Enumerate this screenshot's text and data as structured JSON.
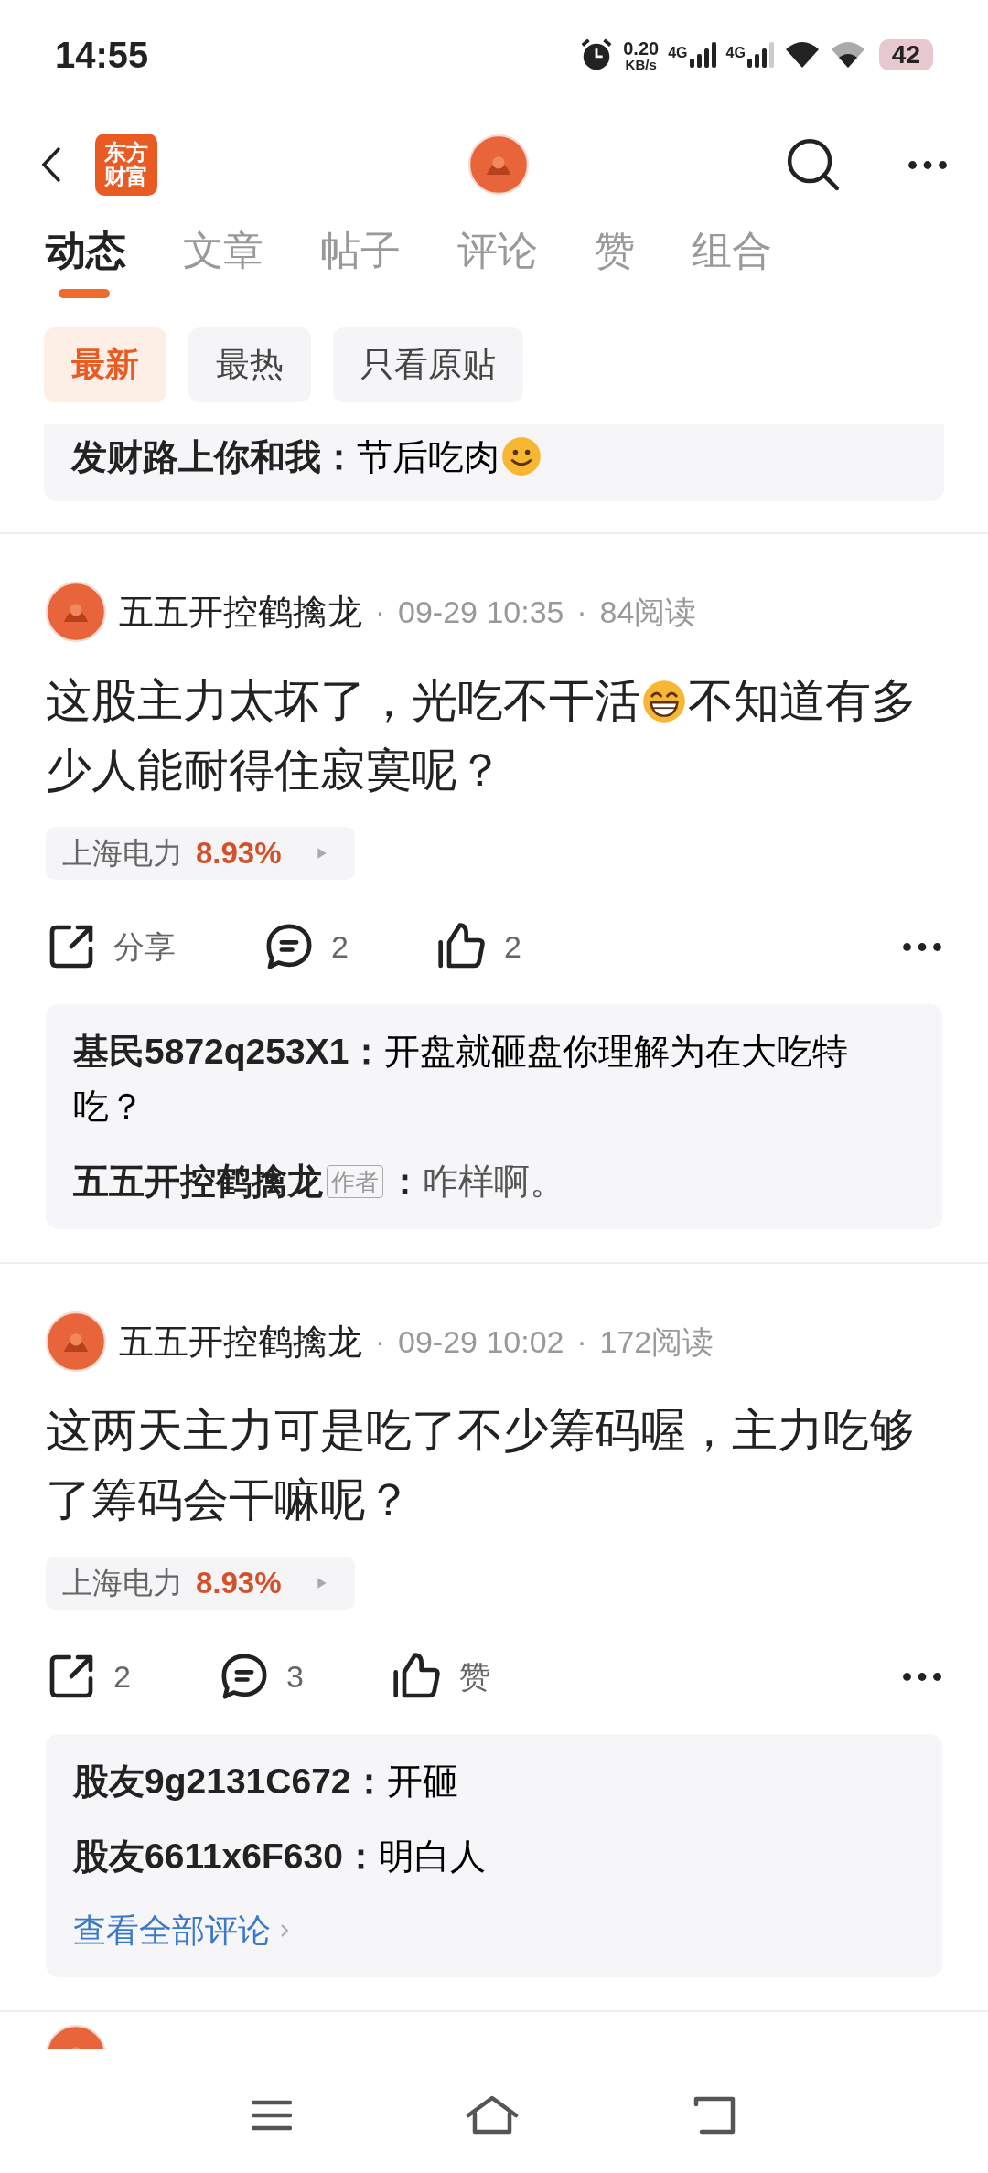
{
  "status_bar": {
    "time": "14:55",
    "speed": "0.20",
    "speed_unit": "KB/s",
    "networks": [
      "4G",
      "4G"
    ],
    "battery": "42"
  },
  "header": {
    "logo": [
      "东方",
      "财富"
    ]
  },
  "tabs": [
    {
      "label": "动态",
      "selected": true
    },
    {
      "label": "文章",
      "selected": false
    },
    {
      "label": "帖子",
      "selected": false
    },
    {
      "label": "评论",
      "selected": false
    },
    {
      "label": "赞",
      "selected": false
    },
    {
      "label": "组合",
      "selected": false
    }
  ],
  "filters": [
    {
      "label": "最新",
      "selected": true
    },
    {
      "label": "最热",
      "selected": false
    },
    {
      "label": "只看原贴",
      "selected": false
    }
  ],
  "partial_replies": [
    {
      "user": "发财路上你和我",
      "sep": "：",
      "parts": [
        {
          "kind": "text",
          "text": "节后吃肉"
        },
        {
          "kind": "smile"
        }
      ]
    }
  ],
  "posts": [
    {
      "author": "五五开控鹤擒龙",
      "dot": "·",
      "time": "09-29 10:35",
      "reads": "84阅读",
      "body": [
        {
          "kind": "text",
          "text": "这股主力太坏了，光吃不干活"
        },
        {
          "kind": "grin"
        },
        {
          "kind": "text",
          "text": "不知道有多少人能耐得住寂寞呢？"
        }
      ],
      "stock": {
        "name": "上海电力",
        "change": "8.93%"
      },
      "share": "分享",
      "comments": "2",
      "likes": "2",
      "replies": [
        {
          "user": "基民5872q253X1",
          "sep": "：",
          "parts": [
            {
              "kind": "text",
              "text": "开盘就砸盘你理解为在大吃特吃？"
            }
          ]
        },
        {
          "user": "五五开控鹤擒龙",
          "badge": "作者",
          "sep": "：",
          "parts": [
            {
              "kind": "text",
              "text": "咋样啊。"
            }
          ]
        }
      ]
    },
    {
      "author": "五五开控鹤擒龙",
      "dot": "·",
      "time": "09-29 10:02",
      "reads": "172阅读",
      "body": [
        {
          "kind": "text",
          "text": "这两天主力可是吃了不少筹码喔，主力吃够了筹码会干嘛呢？"
        }
      ],
      "stock": {
        "name": "上海电力",
        "change": "8.93%"
      },
      "share": "2",
      "comments": "3",
      "likes": "赞",
      "replies": [
        {
          "user": "股友9g2131C672",
          "sep": "：",
          "parts": [
            {
              "kind": "text",
              "text": "开砸"
            }
          ]
        },
        {
          "user": "股友6611x6F630",
          "sep": "：",
          "parts": [
            {
              "kind": "text",
              "text": "明白人"
            }
          ]
        }
      ],
      "view_all": "查看全部评论"
    }
  ]
}
